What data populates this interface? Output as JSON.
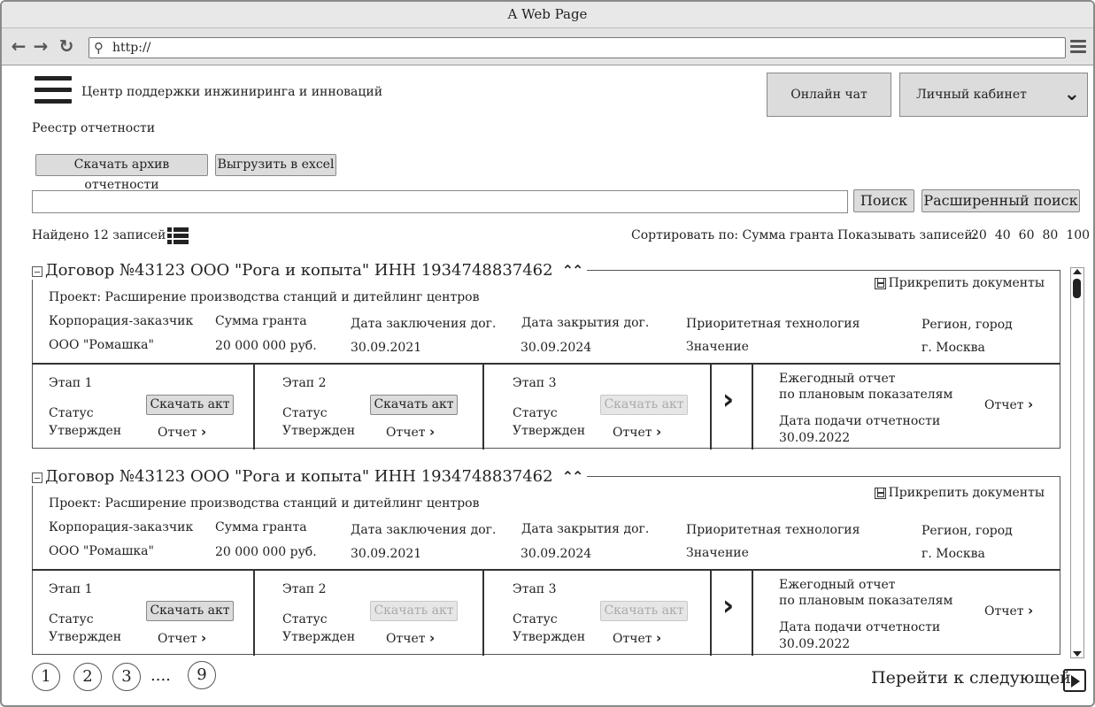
{
  "browser": {
    "title": "A Web Page",
    "url": "http://"
  },
  "header": {
    "site_title": "Центр поддержки инжиниринга и инноваций",
    "chat_button": "Онлайн чат",
    "cabinet_button": "Личный кабинет"
  },
  "page": {
    "title": "Реестр отчетности",
    "download_archive": "Скачать архив отчетности",
    "export_excel": "Выгрузить в excel",
    "search_button": "Поиск",
    "advanced_search": "Расширенный поиск",
    "search_value": ""
  },
  "list_bar": {
    "found": "Найдено 12 записей",
    "sort": "Сортировать по: Сумма гранта",
    "show_label": "Показывать записей:",
    "show_options": [
      "20",
      "40",
      "60",
      "80",
      "100"
    ]
  },
  "cards": [
    {
      "header": "Договор №43123  ООО \"Рога и копыта\"  ИНН 1934748837462",
      "attach": "Прикрепить документы",
      "project": "Проект: Расширение производства станций и дитейлинг центров",
      "fields": [
        {
          "label": "Корпорация-заказчик",
          "value": "ООО \"Ромашка\""
        },
        {
          "label": "Сумма гранта",
          "value": "20 000 000 руб."
        },
        {
          "label": "Дата заключения дог.",
          "value": "30.09.2021"
        },
        {
          "label": "Дата закрытия дог.",
          "value": "30.09.2024"
        },
        {
          "label": "Приоритетная технология",
          "value": "Значение"
        },
        {
          "label": "Регион, город",
          "value": "г. Москва"
        }
      ],
      "stages": [
        {
          "name": "Этап 1",
          "status_label": "Статус",
          "status": "Утвержден",
          "act": "Скачать акт",
          "act_enabled": true,
          "report": "Отчет"
        },
        {
          "name": "Этап 2",
          "status_label": "Статус",
          "status": "Утвержден",
          "act": "Скачать акт",
          "act_enabled": true,
          "report": "Отчет"
        },
        {
          "name": "Этап 3",
          "status_label": "Статус",
          "status": "Утвержден",
          "act": "Скачать акт",
          "act_enabled": false,
          "report": "Отчет"
        }
      ],
      "annual": {
        "line1": "Ежегодный отчет",
        "line2": "по плановым показателям",
        "date_label": "Дата подачи отчетности",
        "date": "30.09.2022",
        "report": "Отчет"
      }
    },
    {
      "header": "Договор №43123  ООО \"Рога и копыта\"  ИНН 1934748837462",
      "attach": "Прикрепить документы",
      "project": "Проект: Расширение производства станций и дитейлинг центров",
      "fields": [
        {
          "label": "Корпорация-заказчик",
          "value": "ООО \"Ромашка\""
        },
        {
          "label": "Сумма гранта",
          "value": "20 000 000 руб."
        },
        {
          "label": "Дата заключения дог.",
          "value": "30.09.2021"
        },
        {
          "label": "Дата закрытия дог.",
          "value": "30.09.2024"
        },
        {
          "label": "Приоритетная технология",
          "value": "Значение"
        },
        {
          "label": "Регион, город",
          "value": "г. Москва"
        }
      ],
      "stages": [
        {
          "name": "Этап 1",
          "status_label": "Статус",
          "status": "Утвержден",
          "act": "Скачать акт",
          "act_enabled": true,
          "report": "Отчет"
        },
        {
          "name": "Этап 2",
          "status_label": "Статус",
          "status": "Утвержден",
          "act": "Скачать акт",
          "act_enabled": false,
          "report": "Отчет"
        },
        {
          "name": "Этап 3",
          "status_label": "Статус",
          "status": "Утвержден",
          "act": "Скачать акт",
          "act_enabled": false,
          "report": "Отчет"
        }
      ],
      "annual": {
        "line1": "Ежегодный отчет",
        "line2": "по плановым показателям",
        "date_label": "Дата подачи отчетности",
        "date": "30.09.2022",
        "report": "Отчет"
      }
    }
  ],
  "pagination": {
    "pages": [
      "1",
      "2",
      "3"
    ],
    "ellipsis": "....",
    "last": "9",
    "next": "Перейти к следующей"
  }
}
